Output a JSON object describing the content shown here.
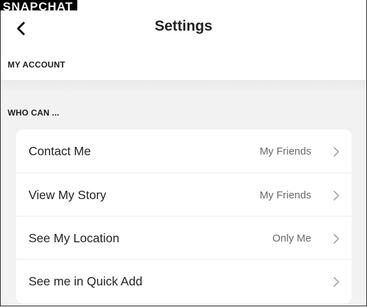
{
  "app": {
    "brand": "SNAPCHAT"
  },
  "header": {
    "title": "Settings"
  },
  "sections": {
    "my_account": "MY ACCOUNT",
    "who_can": "WHO CAN ..."
  },
  "rows": [
    {
      "label": "Contact Me",
      "value": "My Friends"
    },
    {
      "label": "View My Story",
      "value": "My Friends"
    },
    {
      "label": "See My Location",
      "value": "Only Me"
    },
    {
      "label": "See me in Quick Add",
      "value": ""
    }
  ],
  "icons": {
    "back": "chevron-left-icon",
    "row_arrow": "chevron-right-icon"
  },
  "colors": {
    "background": "#f2f2f2",
    "card": "#ffffff",
    "text": "#222222",
    "secondary_text": "#6a6a6a",
    "chevron": "#a8a8a8"
  }
}
